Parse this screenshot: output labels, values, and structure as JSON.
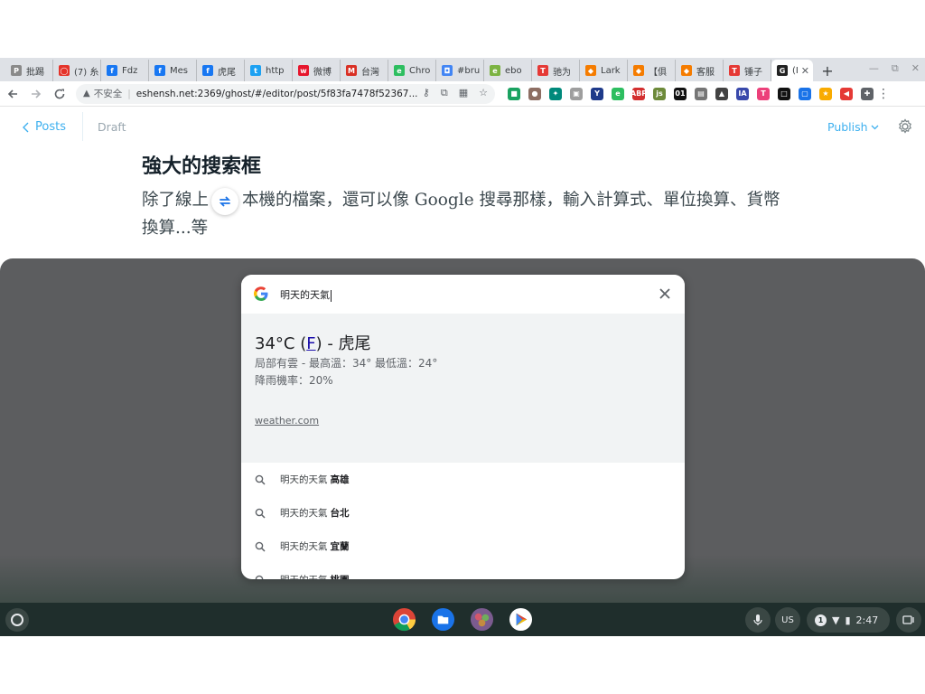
{
  "browser": {
    "tabs": [
      {
        "title": "批踢",
        "fav_color": "#8a8a8a",
        "fav_glyph": "P"
      },
      {
        "title": "(7) 糸",
        "fav_color": "#e4332a",
        "fav_glyph": "◯"
      },
      {
        "title": "Fdz",
        "fav_color": "#1877f2",
        "fav_glyph": "f"
      },
      {
        "title": "Mes",
        "fav_color": "#1877f2",
        "fav_glyph": "f"
      },
      {
        "title": "虎尾",
        "fav_color": "#1877f2",
        "fav_glyph": "f"
      },
      {
        "title": "http",
        "fav_color": "#1da1f2",
        "fav_glyph": "t"
      },
      {
        "title": "微博",
        "fav_color": "#e6162d",
        "fav_glyph": "w"
      },
      {
        "title": "台灣",
        "fav_color": "#d93025",
        "fav_glyph": "M"
      },
      {
        "title": "Chro",
        "fav_color": "#2dbe60",
        "fav_glyph": "e"
      },
      {
        "title": "#bru",
        "fav_color": "#4285f4",
        "fav_glyph": "◘"
      },
      {
        "title": "ebo",
        "fav_color": "#7cb342",
        "fav_glyph": "e"
      },
      {
        "title": "驰为",
        "fav_color": "#e53935",
        "fav_glyph": "T"
      },
      {
        "title": "Lark",
        "fav_color": "#f57c00",
        "fav_glyph": "◆"
      },
      {
        "title": "【俱",
        "fav_color": "#f57c00",
        "fav_glyph": "◆"
      },
      {
        "title": "客服",
        "fav_color": "#f57c00",
        "fav_glyph": "◆"
      },
      {
        "title": "锤子",
        "fav_color": "#e53935",
        "fav_glyph": "T"
      },
      {
        "title": "(I",
        "fav_color": "#222222",
        "fav_glyph": "G",
        "active": true
      }
    ],
    "new_tab_label": "+",
    "omnibox": {
      "security_label": "不安全",
      "url": "eshensh.net:2369/ghost/#/editor/post/5f83fa7478f52367..."
    },
    "extensions": [
      {
        "name": "ext-green-icon",
        "color": "#1aa260",
        "glyph": "■"
      },
      {
        "name": "ext-ammo-icon",
        "color": "#8d6e63",
        "glyph": "●"
      },
      {
        "name": "ext-puzzle-icon",
        "color": "#00897b",
        "glyph": "✦"
      },
      {
        "name": "ext-box-icon",
        "color": "#9e9e9e",
        "glyph": "▣"
      },
      {
        "name": "ext-y-icon",
        "color": "#1e3a8a",
        "glyph": "Y"
      },
      {
        "name": "ext-evernote-icon",
        "color": "#2dbe60",
        "glyph": "e"
      },
      {
        "name": "adblock-plus-icon",
        "color": "#d32f2f",
        "glyph": "ABP"
      },
      {
        "name": "ext-js-icon",
        "color": "#6d8a3a",
        "glyph": "js"
      },
      {
        "name": "ext-binary-icon",
        "color": "#111111",
        "glyph": "01"
      },
      {
        "name": "ext-doc-icon",
        "color": "#757575",
        "glyph": "▤"
      },
      {
        "name": "ext-cat-icon",
        "color": "#424242",
        "glyph": "▲"
      },
      {
        "name": "ext-ia-icon",
        "color": "#3949ab",
        "glyph": "IA"
      },
      {
        "name": "ext-t-circle-icon",
        "color": "#ec407a",
        "glyph": "T"
      },
      {
        "name": "ext-square-icon",
        "color": "#111111",
        "glyph": "□"
      },
      {
        "name": "ext-blue-square-icon",
        "color": "#1a73e8",
        "glyph": "▢"
      },
      {
        "name": "ext-star-icon",
        "color": "#f9ab00",
        "glyph": "★"
      },
      {
        "name": "ext-megaphone-icon",
        "color": "#e53935",
        "glyph": "◀"
      },
      {
        "name": "extensions-puzzle-icon",
        "color": "#5f6368",
        "glyph": "✚"
      }
    ]
  },
  "editor": {
    "back_label": "Posts",
    "status_label": "Draft",
    "publish_label": "Publish",
    "heading": "強大的搜索框",
    "paragraph": "除了線上　　本機的檔案，還可以像 Google 搜尋那樣，輸入計算式、單位換算、貨幣換算...等"
  },
  "launcher": {
    "query": "明天的天氣",
    "answer": {
      "temp_prefix": "34°C (",
      "temp_unit": "F",
      "temp_suffix": ") - 虎尾",
      "condition": "局部有雲 - 最高溫：34° 最低溫：24°",
      "rain": "降雨機率：20%",
      "source": "weather.com"
    },
    "suggestions": [
      {
        "base": "明天的天氣",
        "extra": "高雄"
      },
      {
        "base": "明天的天氣",
        "extra": "台北"
      },
      {
        "base": "明天的天氣",
        "extra": "宜蘭"
      },
      {
        "base": "明天的天氣",
        "extra": "桃園"
      }
    ]
  },
  "shelf": {
    "apps": [
      {
        "name": "chrome-app-icon"
      },
      {
        "name": "files-app-icon"
      },
      {
        "name": "custom-app-icon"
      },
      {
        "name": "play-store-app-icon"
      }
    ],
    "ime_label": "US",
    "notification_count": "1",
    "time": "2:47"
  },
  "colors": {
    "accent": "#3eb0ef",
    "overlay": "#5c5d5f",
    "shelf": "#1f2e2c"
  }
}
